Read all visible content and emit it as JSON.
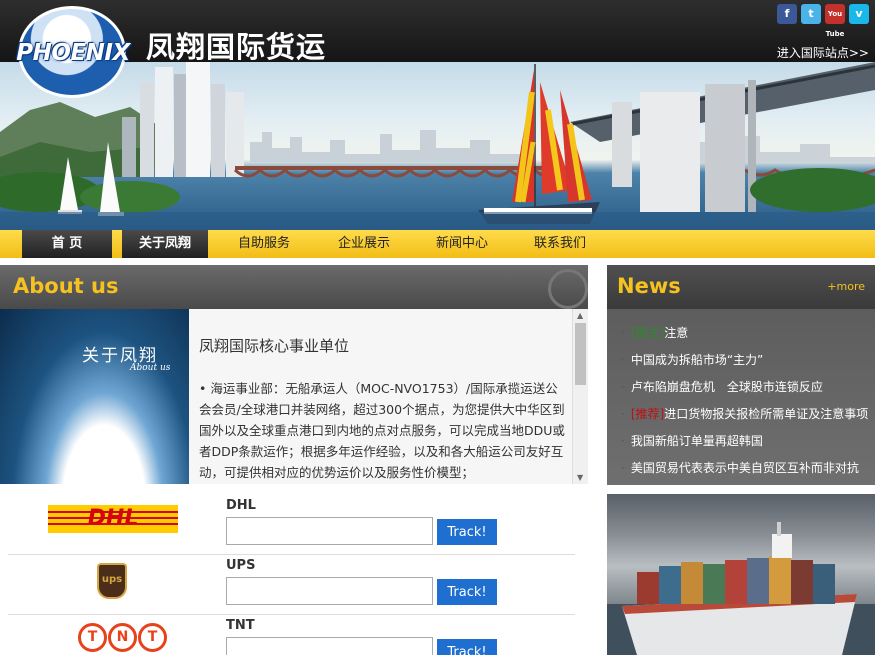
{
  "header": {
    "logo_text": "PHOENIX",
    "site_title": "凤翔国际货运",
    "intl_link": "进入国际站点>>",
    "social": [
      {
        "label": "f",
        "icon": "facebook-icon"
      },
      {
        "label": "t",
        "icon": "twitter-icon"
      },
      {
        "label": "You Tube",
        "icon": "youtube-icon"
      },
      {
        "label": "v",
        "icon": "vimeo-icon"
      }
    ]
  },
  "nav": {
    "items": [
      {
        "label": "首 页",
        "active": true
      },
      {
        "label": "关于凤翔",
        "active": true
      },
      {
        "label": "自助服务",
        "active": false
      },
      {
        "label": "企业展示",
        "active": false
      },
      {
        "label": "新闻中心",
        "active": false
      },
      {
        "label": "联系我们",
        "active": false
      }
    ]
  },
  "about": {
    "title": "About us",
    "image_title": "关于凤翔",
    "image_subtitle": "About us",
    "heading": "凤翔国际核心事业单位",
    "paragraph": "• 海运事业部：无船承运人（MOC-NVO1753）/国际承揽运送公会会员/全球港口并装网络，超过300个据点，为您提供大中华区到国外以及全球重点港口到内地的点对点服务，可以完成当地DDU或者DDP条款运作；根据多年运作经验，以及和各大船运公司友好互动，可提供相对应的优势运价以及服务性价模型；"
  },
  "tracking": {
    "button_label": "Track!",
    "carriers": [
      {
        "name": "DHL",
        "logo": "DHL",
        "icon": "dhl-logo-icon"
      },
      {
        "name": "UPS",
        "logo": "ups",
        "icon": "ups-logo-icon"
      },
      {
        "name": "TNT",
        "logo": "TNT",
        "icon": "tnt-logo-icon"
      }
    ]
  },
  "news": {
    "title": "News",
    "more": "+more",
    "items": [
      {
        "tag": "[图文]",
        "tag_color": "green",
        "text": "注意"
      },
      {
        "tag": "",
        "tag_color": "",
        "text": "中国成为拆船市场“主力”"
      },
      {
        "tag": "",
        "tag_color": "",
        "text": "卢布陷崩盘危机　全球股市连锁反应"
      },
      {
        "tag": "[推荐]",
        "tag_color": "red",
        "text": "进口货物报关报检所需单证及注意事项"
      },
      {
        "tag": "",
        "tag_color": "",
        "text": "我国新船订单量再超韩国"
      },
      {
        "tag": "",
        "tag_color": "",
        "text": "美国贸易代表表示中美自贸区互补而非对抗"
      }
    ]
  },
  "colors": {
    "accent_yellow": "#f5c21f",
    "nav_yellow": "#f8cd2a",
    "track_button": "#1f6fd1"
  }
}
